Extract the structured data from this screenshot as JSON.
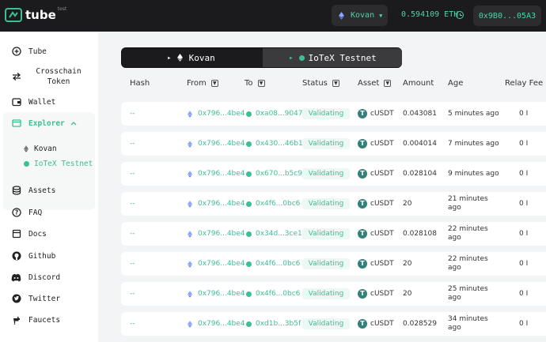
{
  "brand": {
    "name": "tube",
    "superscript": "test"
  },
  "header": {
    "network": "Kovan",
    "balance": "0.594109 ETH",
    "address": "0x9B0...05A3"
  },
  "sidebar": {
    "items": [
      {
        "label": "Tube",
        "icon": "plus-circle-icon"
      },
      {
        "label": "Crosschain Token",
        "icon": "swap-arrows-icon"
      },
      {
        "label": "Wallet",
        "icon": "wallet-icon"
      },
      {
        "label": "Explorer",
        "icon": "explorer-icon"
      },
      {
        "label": "Assets",
        "icon": "assets-icon"
      },
      {
        "label": "FAQ",
        "icon": "question-icon"
      },
      {
        "label": "Docs",
        "icon": "docs-icon"
      },
      {
        "label": "Github",
        "icon": "github-icon"
      },
      {
        "label": "Discord",
        "icon": "discord-icon"
      },
      {
        "label": "Twitter",
        "icon": "twitter-icon"
      },
      {
        "label": "Faucets",
        "icon": "faucet-icon"
      }
    ],
    "explorer_sub": [
      {
        "label": "Kovan"
      },
      {
        "label": "IoTeX Testnet"
      }
    ]
  },
  "tabs": [
    {
      "label": "Kovan"
    },
    {
      "label": "IoTeX Testnet"
    }
  ],
  "table": {
    "headers": [
      "Hash",
      "From",
      "To",
      "Status",
      "Asset",
      "Amount",
      "Age",
      "Relay Fee"
    ],
    "rows": [
      {
        "hash": "--",
        "from": "0x796...4be4",
        "to": "0xa08...9047",
        "status": "Validating",
        "asset": "cUSDT",
        "amount": "0.043081",
        "age": "5 minutes ago",
        "fee": "0 I"
      },
      {
        "hash": "--",
        "from": "0x796...4be4",
        "to": "0x430...46b1",
        "status": "Validating",
        "asset": "cUSDT",
        "amount": "0.004014",
        "age": "7 minutes ago",
        "fee": "0 I"
      },
      {
        "hash": "--",
        "from": "0x796...4be4",
        "to": "0x670...b5c9",
        "status": "Validating",
        "asset": "cUSDT",
        "amount": "0.028104",
        "age": "9 minutes ago",
        "fee": "0 I"
      },
      {
        "hash": "--",
        "from": "0x796...4be4",
        "to": "0x4f6...0bc6",
        "status": "Validating",
        "asset": "cUSDT",
        "amount": "20",
        "age": "21 minutes ago",
        "fee": "0 I"
      },
      {
        "hash": "--",
        "from": "0x796...4be4",
        "to": "0x34d...3ce1",
        "status": "Validating",
        "asset": "cUSDT",
        "amount": "0.028108",
        "age": "22 minutes ago",
        "fee": "0 I"
      },
      {
        "hash": "--",
        "from": "0x796...4be4",
        "to": "0x4f6...0bc6",
        "status": "Validating",
        "asset": "cUSDT",
        "amount": "20",
        "age": "22 minutes ago",
        "fee": "0 I"
      },
      {
        "hash": "--",
        "from": "0x796...4be4",
        "to": "0x4f6...0bc6",
        "status": "Validating",
        "asset": "cUSDT",
        "amount": "20",
        "age": "25 minutes ago",
        "fee": "0 I"
      },
      {
        "hash": "--",
        "from": "0x796...4be4",
        "to": "0xd1b...3b5f",
        "status": "Validating",
        "asset": "cUSDT",
        "amount": "0.028529",
        "age": "34 minutes ago",
        "fee": "0 I"
      }
    ]
  },
  "colors": {
    "accent": "#3cbf93",
    "topbar": "#1b1b1d",
    "background": "#f3f4f5"
  }
}
